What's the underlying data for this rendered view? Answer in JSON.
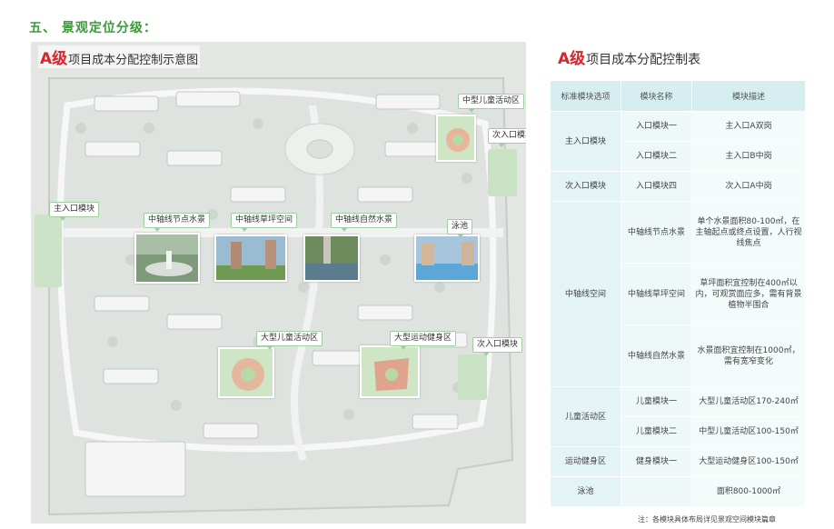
{
  "heading": "五、 景观定位分级：",
  "map": {
    "title_grade": "A级",
    "title_rest": "项目成本分配控制示意图",
    "callouts": {
      "medium_kids": "中型儿童活动区",
      "secondary_entry_top": "次入口模块",
      "main_entry": "主入口模块",
      "axis_node": "中轴线节点水景",
      "axis_lawn": "中轴线草坪空间",
      "axis_natural": "中轴线自然水景",
      "pool": "泳池",
      "large_kids": "大型儿童活动区",
      "large_sport": "大型运动健身区",
      "secondary_entry_right": "次入口模块"
    }
  },
  "table": {
    "title_grade": "A级",
    "title_rest": "项目成本分配控制表",
    "headers": [
      "标准模块选项",
      "模块名称",
      "模块描述"
    ],
    "rows": {
      "main_entry": {
        "category": "主入口模块",
        "r1_module": "入口模块一",
        "r1_desc": "主入口A双岗",
        "r2_module": "入口模块二",
        "r2_desc": "主入口B中岗"
      },
      "secondary_entry": {
        "category": "次入口模块",
        "module": "入口模块四",
        "desc": "次入口A中岗"
      },
      "axis": {
        "category": "中轴线空间",
        "r1_module": "中轴线节点水景",
        "r1_desc": "单个水景面积80-100㎡，在主轴起点或终点设置，人行视线焦点",
        "r2_module": "中轴线草坪空间",
        "r2_desc": "草坪面积宜控制在400㎡以内，可观赏面应多，需有背景植物半围合",
        "r3_module": "中轴线自然水景",
        "r3_desc": "水景面积宜控制在1000㎡，需有宽窄变化"
      },
      "kids": {
        "category": "儿童活动区",
        "r1_module": "儿童模块一",
        "r1_desc": "大型儿童活动区170-240㎡",
        "r2_module": "儿童模块二",
        "r2_desc": "中型儿童活动区100-150㎡"
      },
      "sport": {
        "category": "运动健身区",
        "module": "健身模块一",
        "desc": "大型运动健身区100-150㎡"
      },
      "pool": {
        "category": "泳池",
        "module": "",
        "desc": "面积800-1000㎡"
      }
    },
    "note": "注：各模块具体布局详见景观空间模块篇章"
  }
}
